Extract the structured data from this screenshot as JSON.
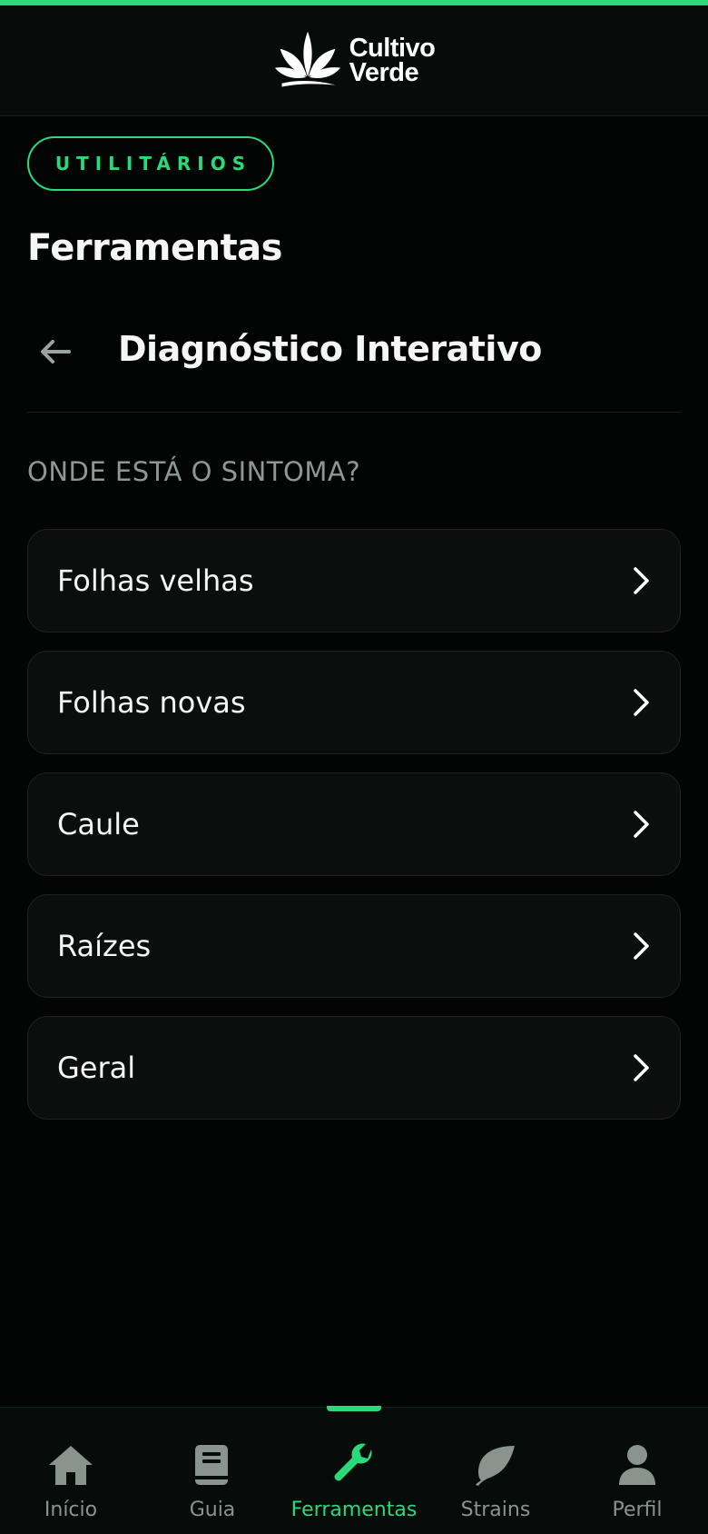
{
  "colors": {
    "accent": "#2bd97a",
    "background": "#030504",
    "card": "#0c0e0d",
    "muted": "#8a948f"
  },
  "brand": {
    "line1": "Cultivo",
    "line2": "Verde",
    "logo_icon": "cannabis-leaf-icon"
  },
  "pill_label": "UTILITÁRIOS",
  "page_title": "Ferramentas",
  "tool": {
    "title": "Diagnóstico Interativo",
    "back_icon": "arrow-left-icon"
  },
  "question": "ONDE ESTÁ O SINTOMA?",
  "options": [
    {
      "label": "Folhas velhas"
    },
    {
      "label": "Folhas novas"
    },
    {
      "label": "Caule"
    },
    {
      "label": "Raízes"
    },
    {
      "label": "Geral"
    }
  ],
  "nav": {
    "active": "Ferramentas",
    "items": [
      {
        "label": "Início",
        "icon": "home-icon"
      },
      {
        "label": "Guia",
        "icon": "book-icon"
      },
      {
        "label": "Ferramentas",
        "icon": "wrench-icon"
      },
      {
        "label": "Strains",
        "icon": "leaf-icon"
      },
      {
        "label": "Perfil",
        "icon": "person-icon"
      }
    ]
  }
}
